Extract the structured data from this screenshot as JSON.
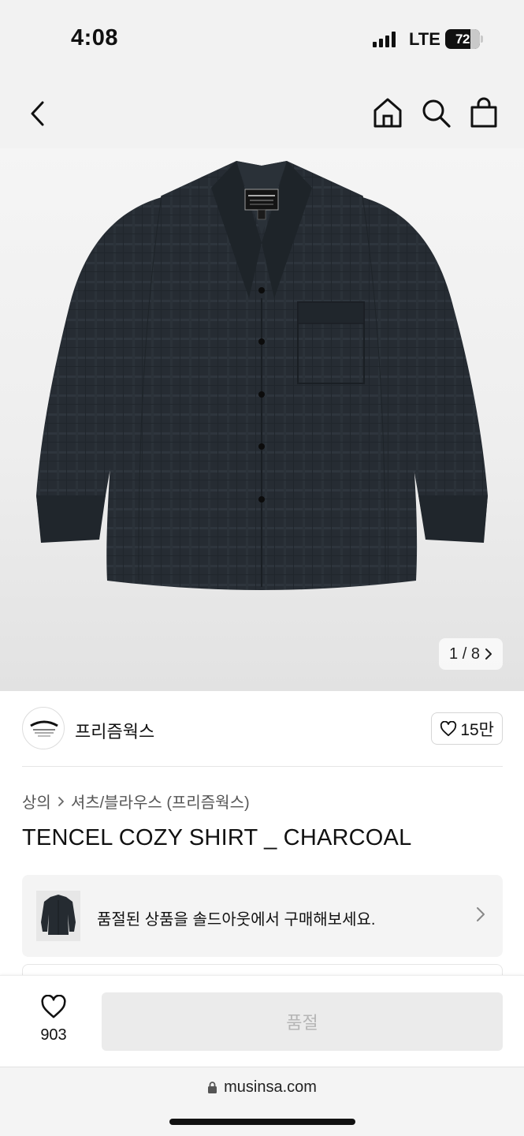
{
  "status_bar": {
    "time": "4:08",
    "network": "LTE",
    "battery_percent": "72",
    "battery_level": 0.72
  },
  "nav": {
    "icons": [
      "back-chevron-icon",
      "home-icon",
      "search-icon",
      "shopping-bag-icon"
    ]
  },
  "gallery": {
    "image": "charcoal open-collar long-sleeve shirt",
    "counter": "1 / 8"
  },
  "brand": {
    "name": "프리즘웍스",
    "like_count": "15만"
  },
  "breadcrumb": {
    "level1": "상의",
    "level2": "셔츠/블라우스 (프리즘웍스)"
  },
  "product": {
    "title": "TENCEL COZY SHIRT _ CHARCOAL"
  },
  "resell_banner": {
    "text": "품절된 상품을 솔드아웃에서 구매해보세요."
  },
  "bottom_bar": {
    "wish_count": "903",
    "buy_label": "품절"
  },
  "browser": {
    "url": "musinsa.com"
  },
  "colors": {
    "shirt": "#252b31",
    "chrome_bg": "#f2f2f2",
    "disabled_button": "#ebebeb",
    "disabled_text": "#b5b5b5"
  }
}
